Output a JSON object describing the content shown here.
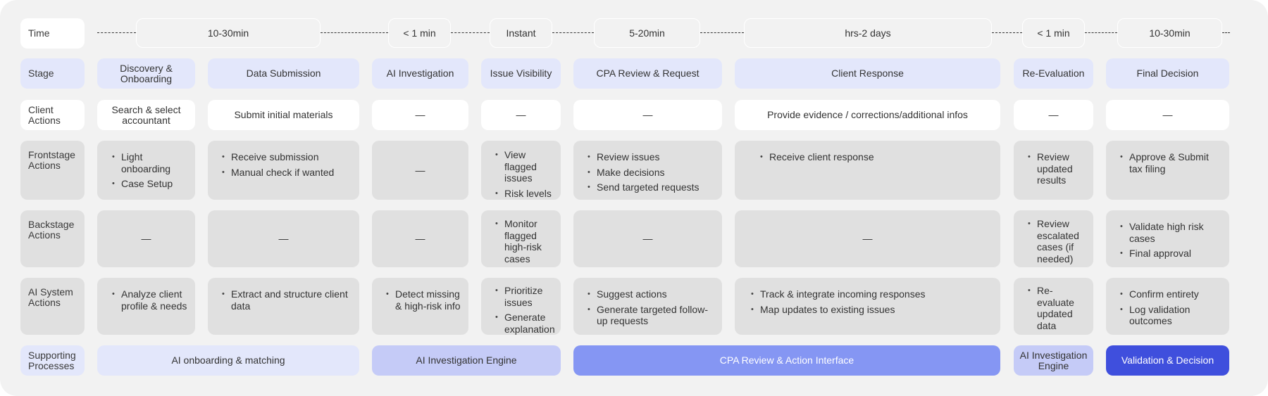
{
  "rows": {
    "time": "Time",
    "stage": "Stage",
    "client_actions": "Client Actions",
    "frontstage_actions": "Frontstage Actions",
    "backstage_actions": "Backstage Actions",
    "ai_system_actions": "AI System Actions",
    "supporting_processes": "Supporting Processes"
  },
  "time": [
    "10-30min",
    "< 1 min",
    "Instant",
    "5-20min",
    "hrs-2 days",
    "< 1 min",
    "10-30min"
  ],
  "stages": [
    "Discovery & Onboarding",
    "Data Submission",
    "AI Investigation",
    "Issue Visibility",
    "CPA Review & Request",
    "Client Response",
    "Re-Evaluation",
    "Final Decision"
  ],
  "client_actions": [
    "Search & select accountant",
    "Submit initial materials",
    "—",
    "—",
    "—",
    "Provide evidence / corrections/additional infos",
    "—",
    "—"
  ],
  "frontstage": {
    "c1": [
      "Light onboarding",
      "Case Setup"
    ],
    "c2": [
      "Receive submission",
      "Manual check if wanted"
    ],
    "c3": "—",
    "c4": [
      "View flagged issues",
      "Risk levels"
    ],
    "c5": [
      "Review issues",
      "Make decisions",
      "Send targeted requests"
    ],
    "c6": [
      "Receive client response"
    ],
    "c7": [
      "Review updated results"
    ],
    "c8": [
      "Approve & Submit tax filing"
    ]
  },
  "backstage": {
    "c1": "—",
    "c2": "—",
    "c3": "—",
    "c4": [
      "Monitor flagged high-risk cases"
    ],
    "c5": "—",
    "c6": "—",
    "c7": [
      "Review escalated cases (if needed)"
    ],
    "c8": [
      "Validate high risk cases",
      "Final approval"
    ]
  },
  "ai_system": {
    "c1": [
      "Analyze client profile & needs"
    ],
    "c2": [
      "Extract and structure client data"
    ],
    "c3": [
      "Detect missing & high-risk info"
    ],
    "c4": [
      "Prioritize issues",
      "Generate explanation"
    ],
    "c5": [
      "Suggest actions",
      "Generate targeted follow-up requests"
    ],
    "c6": [
      "Track & integrate incoming responses",
      "Map updates to existing issues"
    ],
    "c7": [
      "Re-evaluate updated data"
    ],
    "c8": [
      "Confirm entirety",
      "Log validation outcomes"
    ]
  },
  "supporting": [
    "AI onboarding & matching",
    "AI Investigation Engine",
    "CPA Review & Action Interface",
    "AI Investigation Engine",
    "Validation & Decision"
  ],
  "colors": {
    "board_bg": "#f2f2f2",
    "card_gray": "#e0e0e0",
    "stage_lavender": "#e3e7fb",
    "support_light": "#e3e7fb",
    "support_mid": "#c5cbf7",
    "support_blue": "#8596f3",
    "support_dark": "#3f4fdd"
  }
}
